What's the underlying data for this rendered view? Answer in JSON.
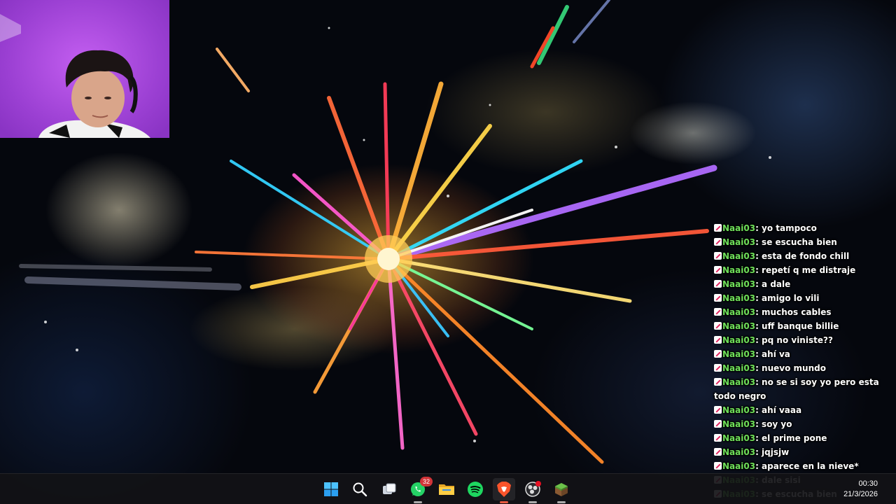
{
  "chat": {
    "messages": [
      {
        "user": "Naai03",
        "text": "yo tampoco"
      },
      {
        "user": "Naai03",
        "text": "se escucha bien"
      },
      {
        "user": "Naai03",
        "text": "esta de fondo chill"
      },
      {
        "user": "Naai03",
        "text": "repetí q me distraje"
      },
      {
        "user": "Naai03",
        "text": "a dale"
      },
      {
        "user": "Naai03",
        "text": "amigo lo vili"
      },
      {
        "user": "Naai03",
        "text": "muchos cables"
      },
      {
        "user": "Naai03",
        "text": "uff banque billie"
      },
      {
        "user": "Naai03",
        "text": "pq no viniste??"
      },
      {
        "user": "Naai03",
        "text": "ahí va"
      },
      {
        "user": "Naai03",
        "text": "nuevo mundo"
      },
      {
        "user": "Naai03",
        "text": "no se si soy yo pero esta todo negro"
      },
      {
        "user": "Naai03",
        "text": "ahí vaaa"
      },
      {
        "user": "Naai03",
        "text": "soy yo"
      },
      {
        "user": "Naai03",
        "text": "el prime pone"
      },
      {
        "user": "Naai03",
        "text": "jqjsjw"
      },
      {
        "user": "Naai03",
        "text": "aparece en la nieve*"
      },
      {
        "user": "Naai03",
        "text": "dale sisi"
      },
      {
        "user": "Naai03",
        "text": "se escucha bien"
      }
    ]
  },
  "taskbar": {
    "icons": [
      {
        "name": "windows-start-icon"
      },
      {
        "name": "search-icon"
      },
      {
        "name": "task-view-icon"
      },
      {
        "name": "whatsapp-icon",
        "badge": "32"
      },
      {
        "name": "file-explorer-icon"
      },
      {
        "name": "spotify-icon"
      },
      {
        "name": "brave-browser-icon"
      },
      {
        "name": "obs-icon"
      },
      {
        "name": "minecraft-icon"
      }
    ],
    "clock": {
      "time": "00:30",
      "date": "21/3/2026"
    }
  },
  "colors": {
    "chat_username": "#6fe05a",
    "webcam_bg": "#b14fe6",
    "taskbar_bg": "#121216",
    "brave_accent": "#e7593f"
  }
}
